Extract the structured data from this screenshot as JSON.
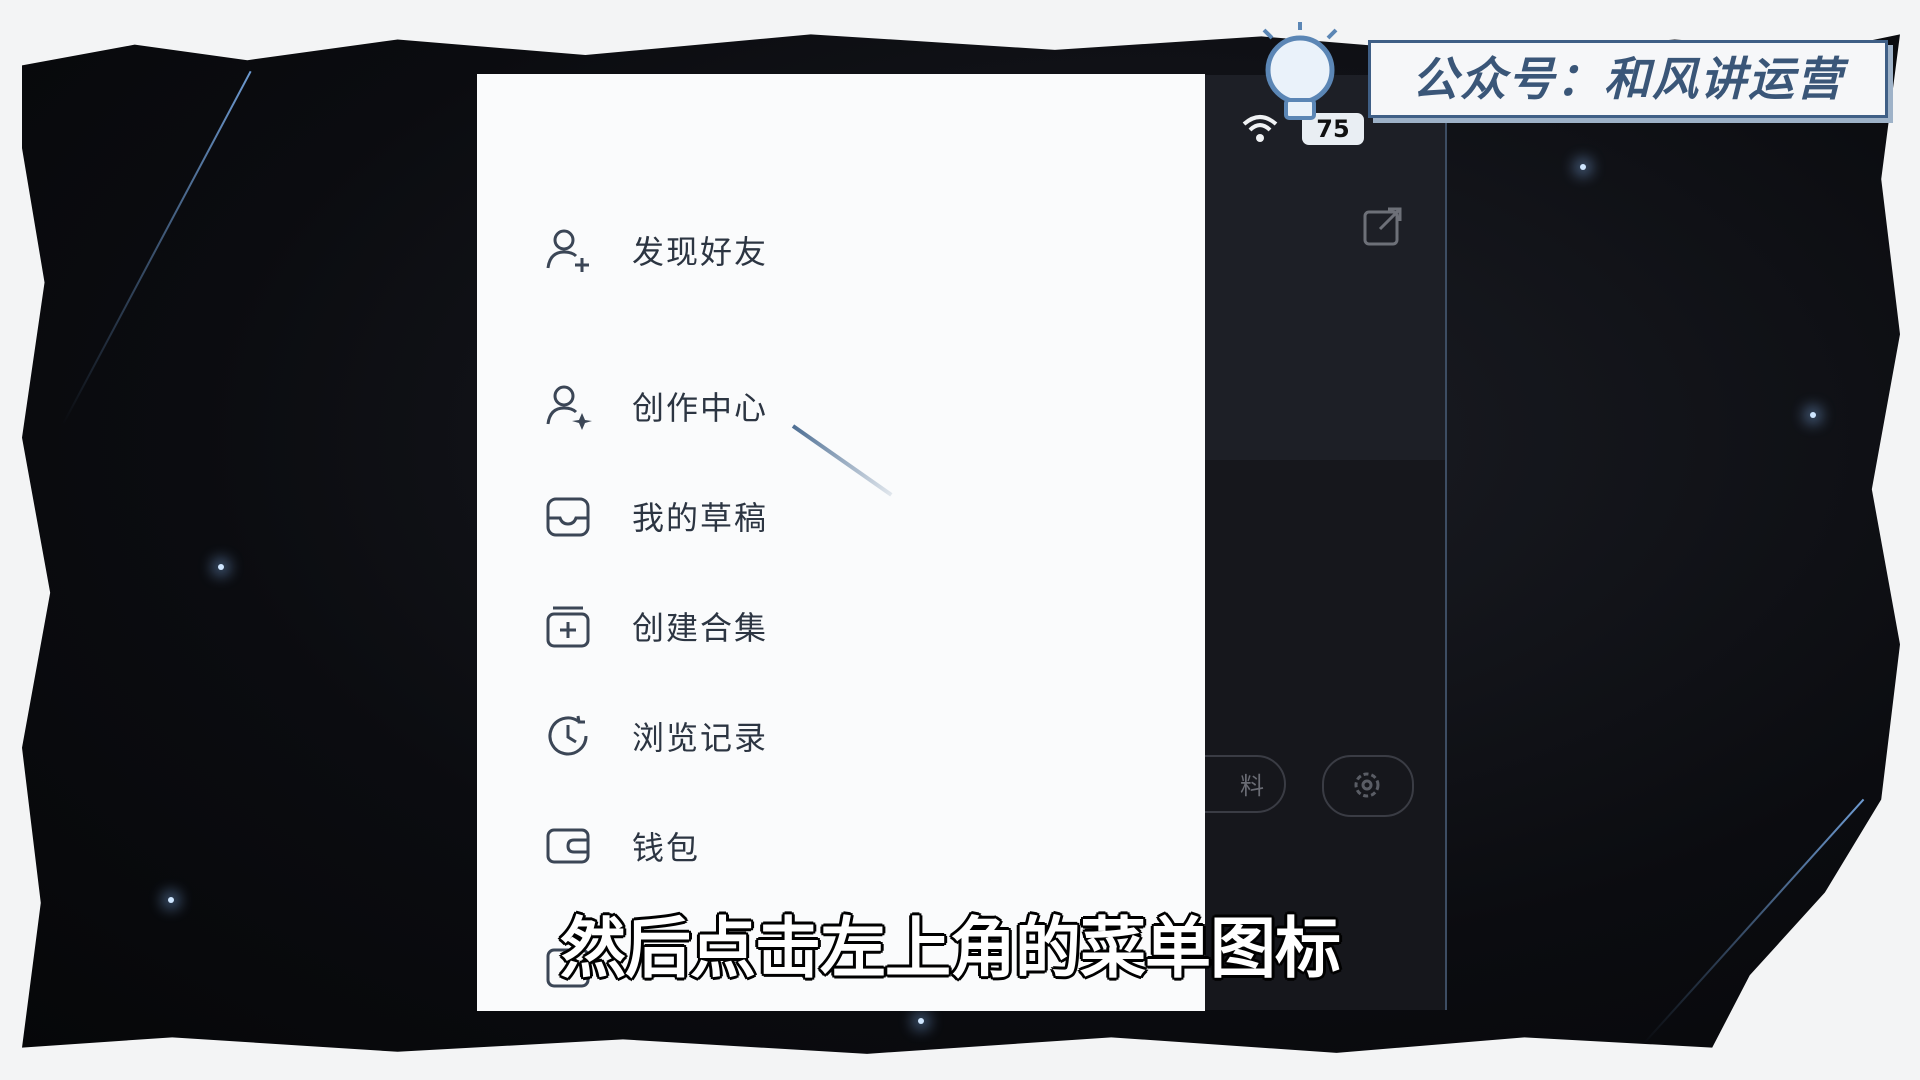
{
  "brand": {
    "label": "公众号：和风讲运营"
  },
  "status_bar": {
    "battery": "75"
  },
  "drawer": {
    "items": [
      {
        "label": "发现好友",
        "icon": "add-friend-icon"
      },
      {
        "label": "创作中心",
        "icon": "creator-center-icon"
      },
      {
        "label": "我的草稿",
        "icon": "drafts-icon"
      },
      {
        "label": "创建合集",
        "icon": "create-collection-icon"
      },
      {
        "label": "浏览记录",
        "icon": "history-icon"
      },
      {
        "label": "钱包",
        "icon": "wallet-icon"
      }
    ]
  },
  "profile_bg": {
    "edit_label": "料"
  },
  "subtitle": "然后点击左上角的菜单图标",
  "colors": {
    "accent": "#3a5678",
    "drawer_bg": "#fafbfc",
    "icon": "#3b4656"
  }
}
